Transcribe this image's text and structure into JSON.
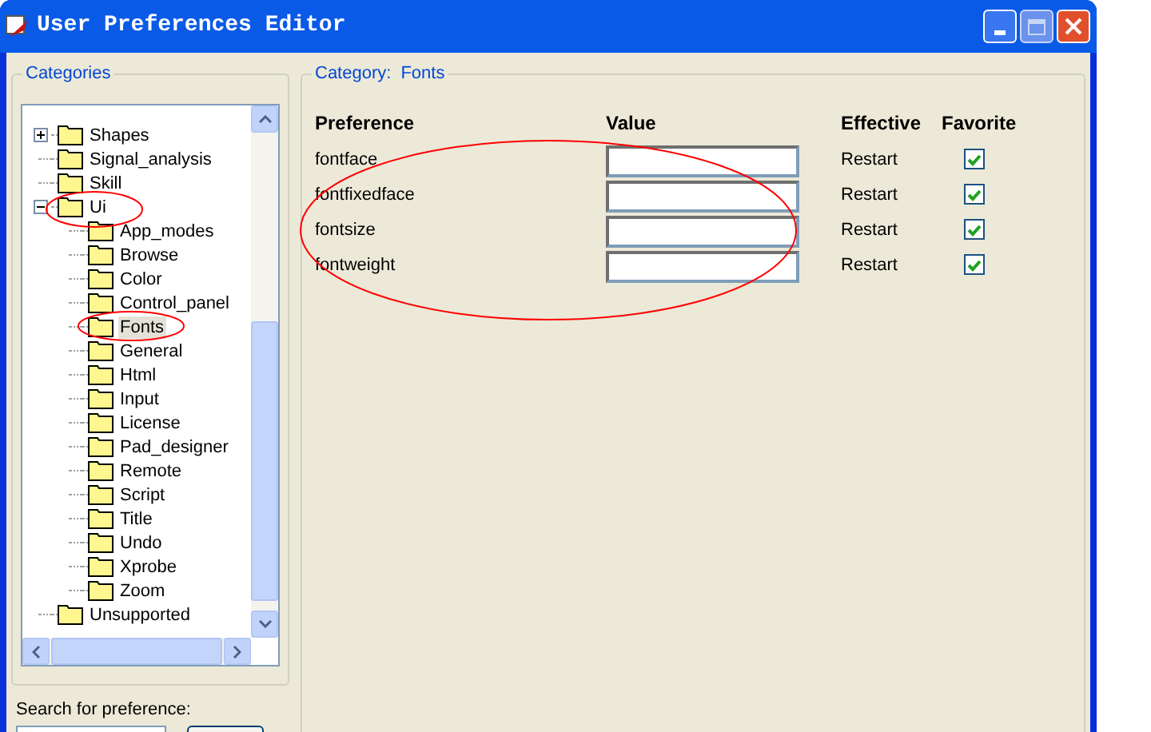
{
  "window": {
    "title": "User Preferences Editor"
  },
  "categories": {
    "title": "Categories",
    "tree": [
      {
        "label": "Shapes",
        "expanded": false,
        "selected": false
      },
      {
        "label": "Signal_analysis",
        "selected": false
      },
      {
        "label": "Skill",
        "selected": false
      },
      {
        "label": "Ui",
        "expanded": true,
        "selected": false,
        "children": [
          {
            "label": "App_modes",
            "selected": false
          },
          {
            "label": "Browse",
            "selected": false
          },
          {
            "label": "Color",
            "selected": false
          },
          {
            "label": "Control_panel",
            "selected": false
          },
          {
            "label": "Fonts",
            "selected": true
          },
          {
            "label": "General",
            "selected": false
          },
          {
            "label": "Html",
            "selected": false
          },
          {
            "label": "Input",
            "selected": false
          },
          {
            "label": "License",
            "selected": false
          },
          {
            "label": "Pad_designer",
            "selected": false
          },
          {
            "label": "Remote",
            "selected": false
          },
          {
            "label": "Script",
            "selected": false
          },
          {
            "label": "Title",
            "selected": false
          },
          {
            "label": "Undo",
            "selected": false
          },
          {
            "label": "Xprobe",
            "selected": false
          },
          {
            "label": "Zoom",
            "selected": false
          }
        ]
      },
      {
        "label": "Unsupported",
        "selected": false
      }
    ]
  },
  "search": {
    "label": "Search for preference:"
  },
  "category": {
    "label": "Category:",
    "name": "Fonts"
  },
  "table": {
    "columns": [
      "Preference",
      "Value",
      "Effective",
      "Favorite"
    ],
    "rows": [
      {
        "preference": "fontface",
        "effective": "Restart",
        "favorite": true
      },
      {
        "preference": "fontfixedface",
        "effective": "Restart",
        "favorite": true
      },
      {
        "preference": "fontsize",
        "effective": "Restart",
        "favorite": true
      },
      {
        "preference": "fontweight",
        "effective": "Restart",
        "favorite": true
      }
    ]
  }
}
